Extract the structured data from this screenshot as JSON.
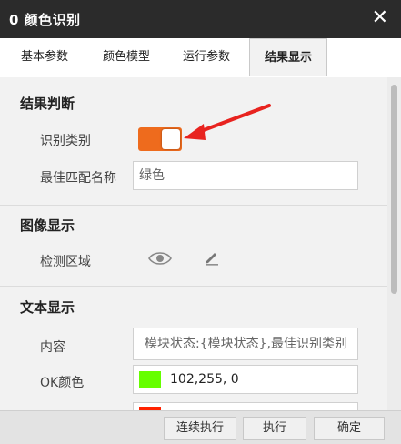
{
  "window": {
    "title": "0 颜色识别",
    "close_glyph": "✕"
  },
  "tabs": [
    {
      "label": "基本参数",
      "active": false
    },
    {
      "label": "颜色模型",
      "active": false
    },
    {
      "label": "运行参数",
      "active": false
    },
    {
      "label": "结果显示",
      "active": true
    }
  ],
  "sections": {
    "result_judgment": {
      "title": "结果判断",
      "identify_category_label": "识别类别",
      "identify_category_on": true,
      "best_match_label": "最佳匹配名称",
      "best_match_value": "绿色"
    },
    "image_display": {
      "title": "图像显示",
      "detect_region_label": "检测区域"
    },
    "text_display": {
      "title": "文本显示",
      "content_label": "内容",
      "content_value": "模块状态:{模块状态},最佳识别类别",
      "ok_color_label": "OK颜色",
      "ok_color_value": "102,255,  0",
      "ok_color_hex": "#66ff00",
      "ng_color_hex": "#ff2200"
    }
  },
  "footer": {
    "run_continuous_label": "连续执行",
    "run_label": "执行",
    "confirm_label": "确定"
  },
  "colors": {
    "titlebar": "#2b2b2b",
    "toggle_on": "#ee6b1d",
    "annotation_arrow": "#e8231f"
  },
  "icons": {
    "visibility": "eye-icon",
    "edit": "pencil-icon"
  }
}
